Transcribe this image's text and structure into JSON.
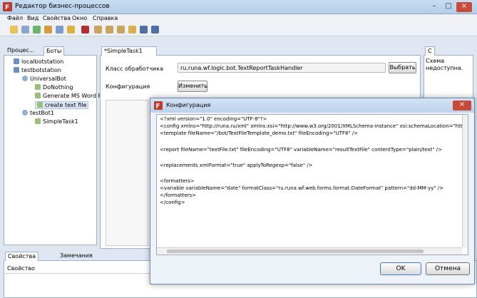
{
  "window": {
    "title": "Редактор бизнес-процессов",
    "controls": [
      "–",
      "□",
      "×"
    ]
  },
  "menu": [
    "Файл",
    "Вид",
    "Свойства",
    "Окно",
    "Справка"
  ],
  "left_panel": {
    "tabs": [
      "Процес...",
      "Боты"
    ],
    "tree": [
      {
        "label": "localbotstation",
        "level": 1,
        "icon": "computer-icon"
      },
      {
        "label": "testbotstation",
        "level": 1,
        "icon": "computer-icon"
      },
      {
        "label": "UniversalBot",
        "level": 2,
        "icon": "user-icon"
      },
      {
        "label": "DoNothing",
        "level": 3,
        "icon": "task-icon"
      },
      {
        "label": "Generate MS Word Re",
        "level": 3,
        "icon": "task-icon"
      },
      {
        "label": "create text file",
        "level": 3,
        "icon": "task-icon",
        "selected": true
      },
      {
        "label": "testBot1",
        "level": 2,
        "icon": "user-icon"
      },
      {
        "label": "SimpleTask1",
        "level": 3,
        "icon": "task-icon"
      }
    ]
  },
  "editor": {
    "tab": "*SimpleTask1",
    "handler_label": "Класс обработчика",
    "handler_value": "ru.runa.wf.logic.bot.TextReportTaskHandler",
    "select_button": "Выбрать",
    "config_label": "Конфигурация",
    "change_button": "Изменить"
  },
  "right_panel": {
    "tab": "С",
    "text_line1": "Схема",
    "text_line2": "недоступна."
  },
  "bottom_panel": {
    "tabs": [
      "Свойства",
      "Замечания"
    ],
    "column": "Свойство"
  },
  "dialog": {
    "title": "Конфигурация",
    "lines": [
      "<?xml version=\"1.0\" encoding=\"UTF-8\"?>",
      "<config xmlns=\"http://runa.ru/xml\" xmlns:xsi=\"http://www.w3.org/2001/XMLSchema-instance\" xsi:schemaLocation=\"http:",
      "    <template fileName=\"/bot/TextFileTemplate_demo.txt\" fileEncoding=\"UTF8\" />",
      "",
      "    <report fileName=\"textFile.txt\" fileEncoding=\"UTF8\" variableName=\"resultTextFile\" contentType=\"plain/text\" />",
      "",
      "    <replacements xmlFormat=\"true\" applyToRegexp=\"false\" />",
      "",
      "     <formatters>",
      "          <variable variableName=\"date\" formatClass=\"ru.runa.wf.web.forms.format.DateFormat\" pattern=\"dd-MM-yy\" />",
      "     </formatters>",
      "</config>"
    ],
    "ok_button": "OK",
    "cancel_button": "Отмена"
  },
  "colors": {
    "accent": "#c0392b",
    "selection": "#dbe8f8"
  }
}
